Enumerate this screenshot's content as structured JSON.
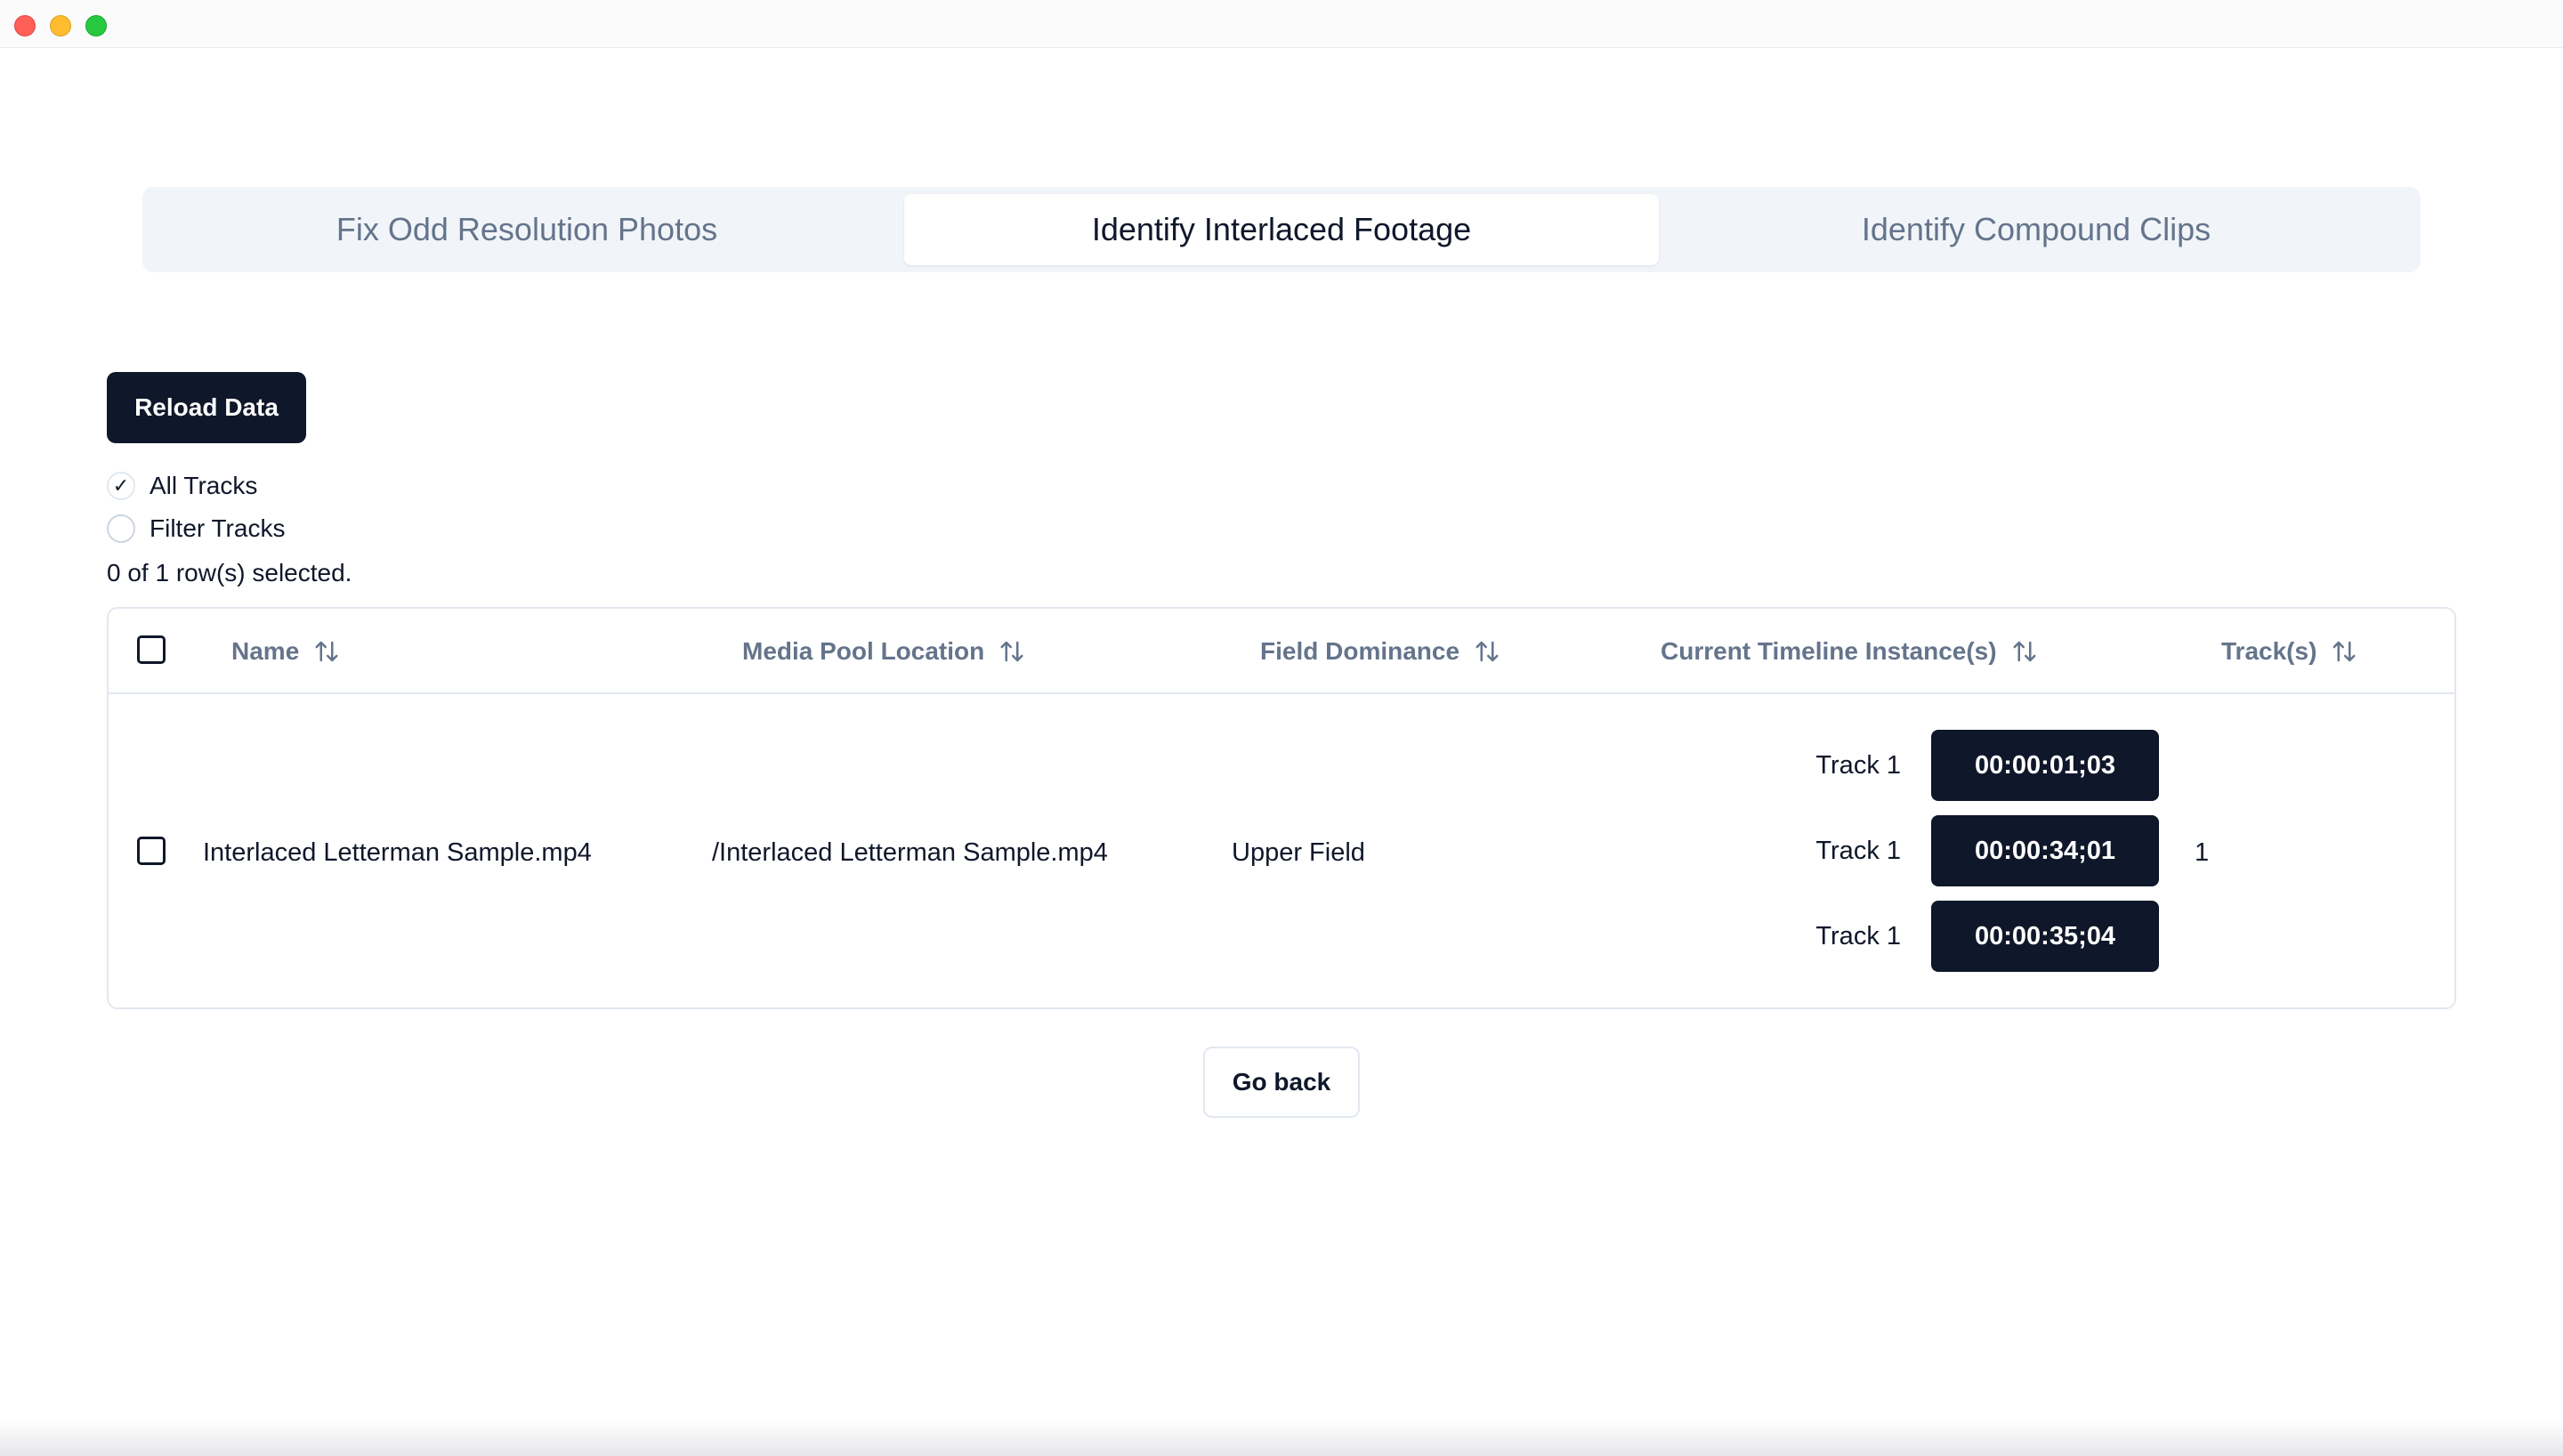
{
  "tabs": [
    {
      "label": "Fix Odd Resolution Photos",
      "active": false
    },
    {
      "label": "Identify Interlaced Footage",
      "active": true
    },
    {
      "label": "Identify Compound Clips",
      "active": false
    }
  ],
  "reload_label": "Reload Data",
  "track_filter": {
    "options": [
      {
        "label": "All Tracks",
        "checked": true
      },
      {
        "label": "Filter Tracks",
        "checked": false
      }
    ],
    "checkmark": "✓"
  },
  "selection_status": "0 of 1 row(s) selected.",
  "table": {
    "columns": [
      {
        "label": "Name",
        "sort_icon": "sort-arrows-icon"
      },
      {
        "label": "Media Pool Location",
        "sort_icon": "sort-arrows-icon"
      },
      {
        "label": "Field Dominance",
        "sort_icon": "sort-arrows-icon"
      },
      {
        "label": "Current Timeline Instance(s)",
        "sort_icon": "sort-arrows-icon"
      },
      {
        "label": "Track(s)",
        "sort_icon": "sort-arrows-icon"
      }
    ],
    "rows": [
      {
        "name": "Interlaced Letterman Sample.mp4",
        "media_pool_location": "/Interlaced Letterman Sample.mp4",
        "field_dominance": "Upper Field",
        "instances": [
          {
            "track": "Track 1",
            "timecode": "00:00:01;03"
          },
          {
            "track": "Track 1",
            "timecode": "00:00:34;01"
          },
          {
            "track": "Track 1",
            "timecode": "00:00:35;04"
          }
        ],
        "tracks": "1"
      }
    ]
  },
  "go_back_label": "Go back",
  "colors": {
    "primary_dark": "#0f172a",
    "muted_text": "#64748b",
    "tab_bg": "#f1f5f9",
    "border": "#e2e8f0"
  }
}
